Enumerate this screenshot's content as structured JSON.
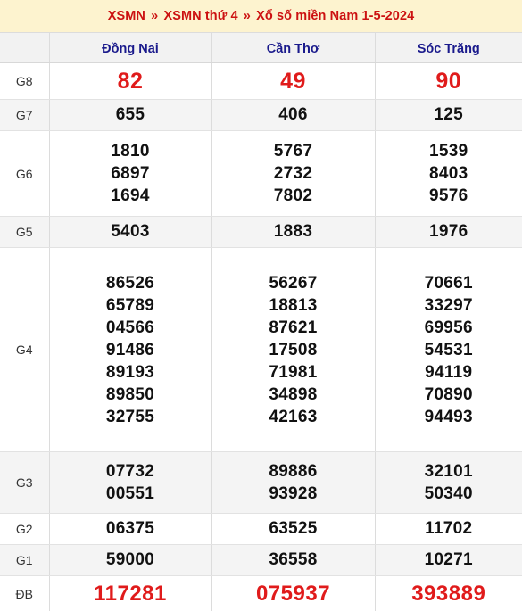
{
  "breadcrumb": {
    "items": [
      {
        "label": "XSMN",
        "type": "link"
      },
      {
        "label": "»",
        "type": "separator"
      },
      {
        "label": "XSMN thứ 4",
        "type": "link"
      },
      {
        "label": "»",
        "type": "separator"
      },
      {
        "label": "Xổ số miền Nam 1-5-2024",
        "type": "link"
      }
    ],
    "full_text": "XSMN » XSMN thứ 4 » Xổ số miền Nam 1-5-2024"
  },
  "colors": {
    "breadcrumb_background": "#fdf3cf",
    "breadcrumb_text": "#cc1111",
    "province_link": "#1a1a8c",
    "highlight_number": "#e01b1b",
    "number_text": "#111111",
    "header_row_background": "#f2f2f2",
    "stripe_background": "#f4f4f4",
    "border": "#dcdcdc"
  },
  "table": {
    "corner_label": "",
    "columns": [
      {
        "label": "Đồng Nai"
      },
      {
        "label": "Cần Thơ"
      },
      {
        "label": "Sóc Trăng"
      }
    ],
    "rows": [
      {
        "prize": "G8",
        "style": "red",
        "stripe": false,
        "values": [
          [
            "82"
          ],
          [
            "49"
          ],
          [
            "90"
          ]
        ]
      },
      {
        "prize": "G7",
        "style": "normal",
        "stripe": true,
        "values": [
          [
            "655"
          ],
          [
            "406"
          ],
          [
            "125"
          ]
        ]
      },
      {
        "prize": "G6",
        "style": "normal",
        "stripe": false,
        "values": [
          [
            "1810",
            "6897",
            "1694"
          ],
          [
            "5767",
            "2732",
            "7802"
          ],
          [
            "1539",
            "8403",
            "9576"
          ]
        ]
      },
      {
        "prize": "G5",
        "style": "normal",
        "stripe": true,
        "values": [
          [
            "5403"
          ],
          [
            "1883"
          ],
          [
            "1976"
          ]
        ]
      },
      {
        "prize": "G4",
        "style": "normal",
        "stripe": false,
        "values": [
          [
            "86526",
            "65789",
            "04566",
            "91486",
            "89193",
            "89850",
            "32755"
          ],
          [
            "56267",
            "18813",
            "87621",
            "17508",
            "71981",
            "34898",
            "42163"
          ],
          [
            "70661",
            "33297",
            "69956",
            "54531",
            "94119",
            "70890",
            "94493"
          ]
        ]
      },
      {
        "prize": "G3",
        "style": "normal",
        "stripe": true,
        "values": [
          [
            "07732",
            "00551"
          ],
          [
            "89886",
            "93928"
          ],
          [
            "32101",
            "50340"
          ]
        ]
      },
      {
        "prize": "G2",
        "style": "normal",
        "stripe": false,
        "values": [
          [
            "06375"
          ],
          [
            "63525"
          ],
          [
            "11702"
          ]
        ]
      },
      {
        "prize": "G1",
        "style": "normal",
        "stripe": true,
        "values": [
          [
            "59000"
          ],
          [
            "36558"
          ],
          [
            "10271"
          ]
        ]
      },
      {
        "prize": "ĐB",
        "style": "db",
        "stripe": false,
        "values": [
          [
            "117281"
          ],
          [
            "075937"
          ],
          [
            "393889"
          ]
        ]
      }
    ]
  }
}
